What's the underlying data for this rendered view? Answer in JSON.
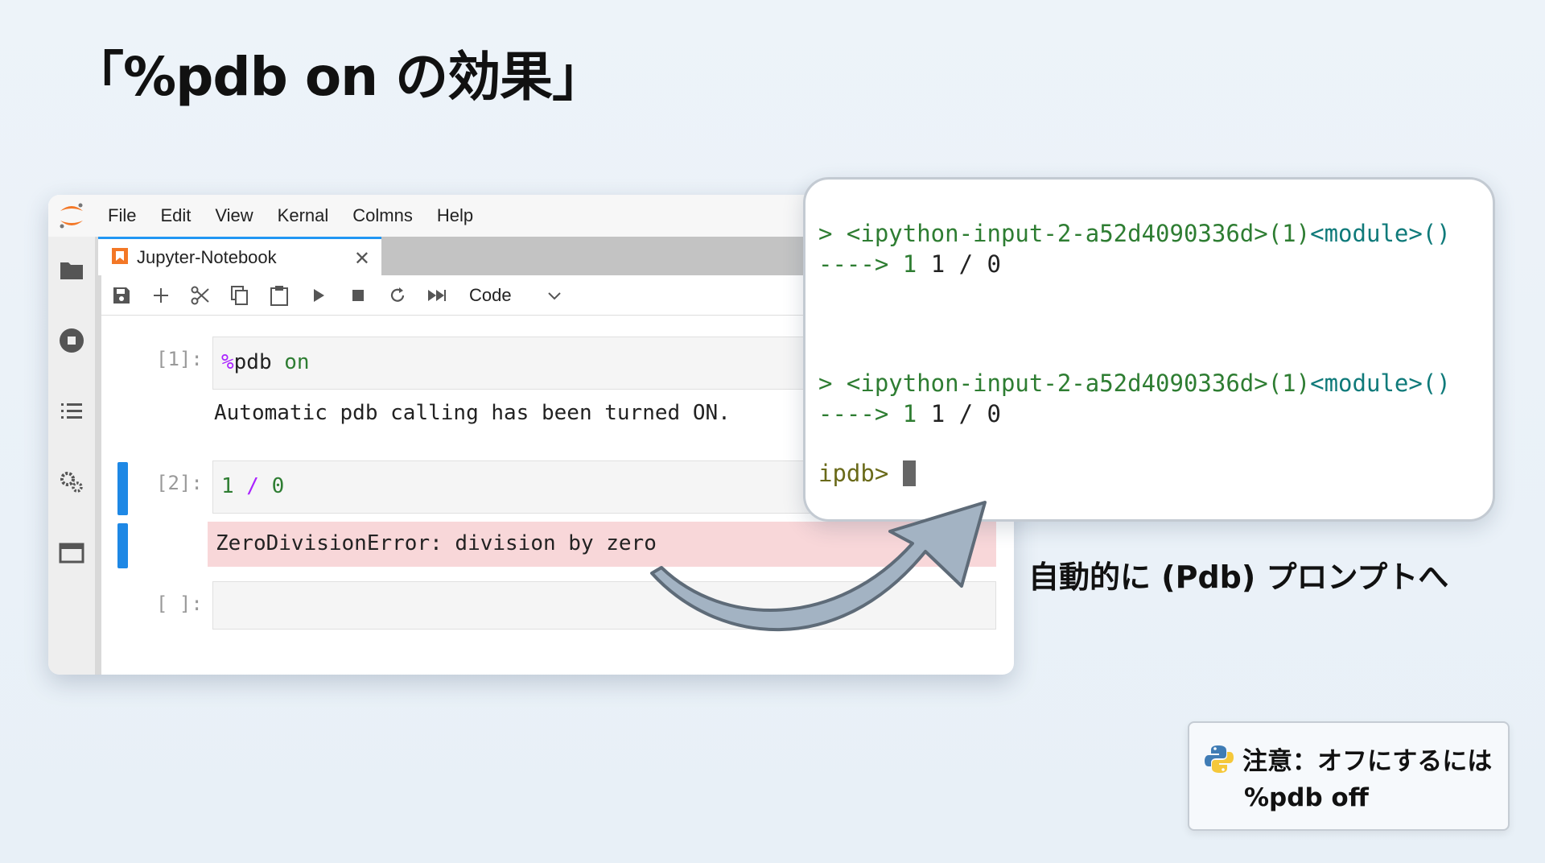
{
  "slide": {
    "title": "「%pdb on の効果」",
    "caption": "自動的に (Pdb) プロンプトへ"
  },
  "menu": [
    "File",
    "Edit",
    "View",
    "Kernal",
    "Colmns",
    "Help"
  ],
  "tab": {
    "label": "Jupyter-Notebook",
    "close": "✕"
  },
  "toolbar": {
    "kernel_type": "Code",
    "icons": [
      "save-icon",
      "add-icon",
      "cut-icon",
      "copy-icon",
      "paste-icon",
      "run-icon",
      "stop-icon",
      "restart-icon",
      "fast-forward-icon"
    ]
  },
  "sidebar_icons": [
    "folder-icon",
    "running-icon",
    "toc-icon",
    "extensions-icon",
    "tabs-icon"
  ],
  "cells": [
    {
      "prompt": "[1]:",
      "code_magic": "%",
      "code_cmd": "pdb",
      "code_arg": " on",
      "output": "Automatic pdb calling has been turned ON."
    },
    {
      "prompt": "[2]:",
      "code_num1": "1",
      "code_op": " / ",
      "code_num2": "0",
      "error": "ZeroDivisionError: division by zero"
    },
    {
      "prompt": "[ ]:"
    }
  ],
  "terminal": {
    "block1": {
      "arrow": "> ",
      "input": "<ipython-input-2-a52d4090336d>",
      "line_ref": "(1)",
      "module": "<module>()",
      "pointer": "---->",
      "lineno": " 1",
      "expr": " 1 / 0"
    },
    "block2": {
      "arrow": "> ",
      "input": "<ipython-input-2-a52d4090336d>",
      "line_ref": "(1)",
      "module": "<module>()",
      "pointer": "---->",
      "lineno": " 1",
      "expr": " 1 / 0"
    },
    "prompt": "ipdb> "
  },
  "note": {
    "line1": "注意：オフにするには",
    "line2": "%pdb off"
  },
  "colors": {
    "active_cell": "#1e88e5",
    "error_bg": "#f8d7d9",
    "terminal_green": "#2e7d32",
    "terminal_teal": "#0f7a7a",
    "magic_purple": "#aa22ff",
    "logo_orange": "#f37726",
    "arrow_fill": "#9fb0c0"
  }
}
